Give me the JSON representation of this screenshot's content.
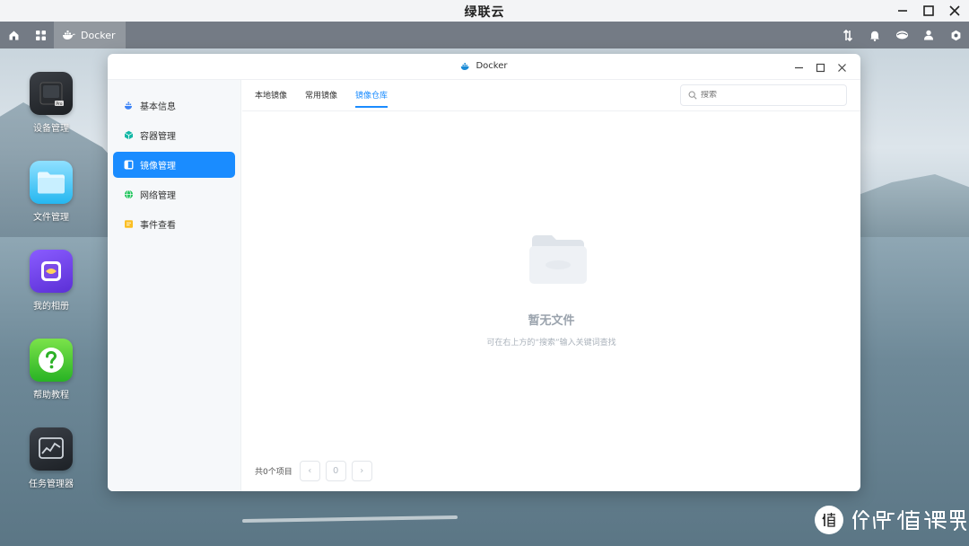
{
  "os": {
    "title": "绿联云",
    "window_controls": [
      "minimize",
      "maximize",
      "close"
    ]
  },
  "taskbar": {
    "left_icons": [
      "home-icon",
      "apps-grid-icon"
    ],
    "active_app": {
      "icon": "docker-whale-icon",
      "label": "Docker"
    },
    "tray_icons": [
      "transfer-icon",
      "bell-icon",
      "cloud-icon",
      "user-icon",
      "gear-icon"
    ]
  },
  "desktop": {
    "icons": [
      {
        "label": "设备管理",
        "icon": "device-manager-icon"
      },
      {
        "label": "文件管理",
        "icon": "folder-icon"
      },
      {
        "label": "我的相册",
        "icon": "photo-album-icon"
      },
      {
        "label": "帮助教程",
        "icon": "help-icon"
      },
      {
        "label": "任务管理器",
        "icon": "task-manager-icon"
      }
    ]
  },
  "window": {
    "title": "Docker",
    "title_icon": "docker-whale-icon",
    "sidebar": [
      {
        "label": "基本信息",
        "icon": "info-icon",
        "active": false
      },
      {
        "label": "容器管理",
        "icon": "container-icon",
        "active": false
      },
      {
        "label": "镜像管理",
        "icon": "image-icon",
        "active": true
      },
      {
        "label": "网络管理",
        "icon": "network-globe-icon",
        "active": false
      },
      {
        "label": "事件查看",
        "icon": "event-log-icon",
        "active": false
      }
    ],
    "tabs": [
      {
        "label": "本地镜像",
        "active": false
      },
      {
        "label": "常用镜像",
        "active": false
      },
      {
        "label": "镜像仓库",
        "active": true
      }
    ],
    "search": {
      "placeholder": "搜索",
      "value": ""
    },
    "empty_state": {
      "title": "暂无文件",
      "hint": "可在右上方的“搜索”输入关键词查找"
    },
    "pagination": {
      "total_label": "共0个项目",
      "current_page": "0",
      "prev": "‹",
      "next": "›"
    }
  },
  "watermark": {
    "text": "什么值得买",
    "logo": "值"
  },
  "colors": {
    "accent": "#1a8cff",
    "sidebar_bg": "#f6f8fa",
    "muted_text": "#9aa3ad"
  }
}
